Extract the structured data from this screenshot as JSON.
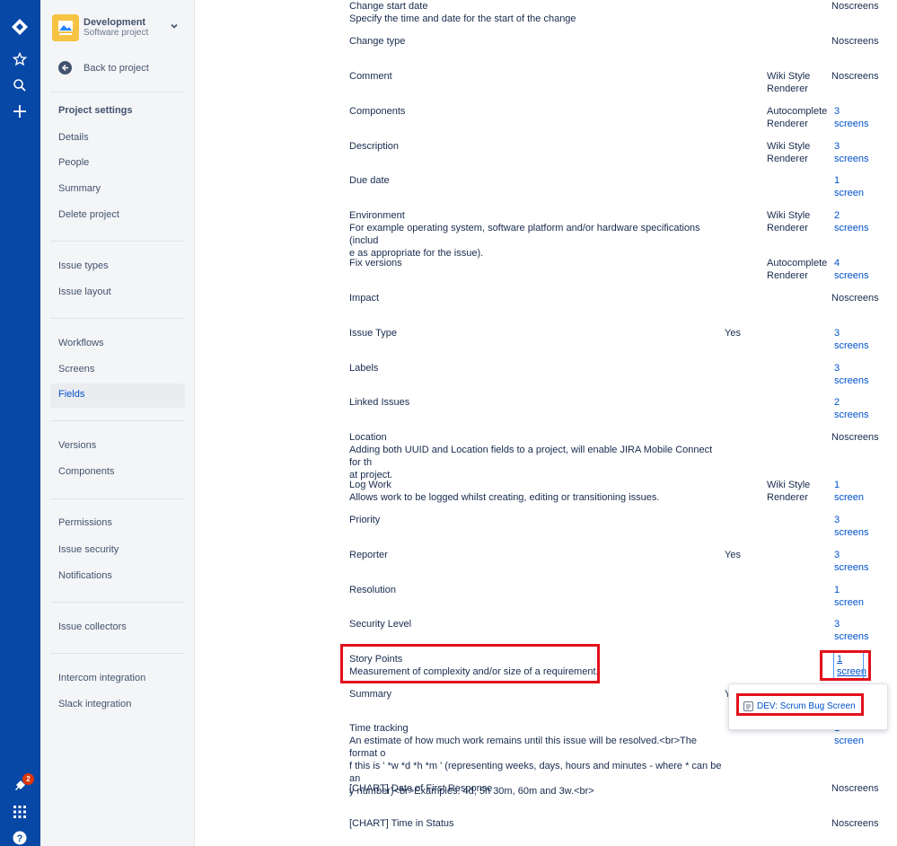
{
  "project": {
    "name": "Development",
    "type": "Software project",
    "back_label": "Back to project"
  },
  "nav": {
    "heading": "Project settings",
    "items_a": [
      "Details",
      "People",
      "Summary",
      "Delete project"
    ],
    "items_b": [
      "Issue types",
      "Issue layout"
    ],
    "items_c": [
      "Workflows",
      "Screens",
      "Fields"
    ],
    "items_d": [
      "Versions",
      "Components"
    ],
    "items_e": [
      "Permissions",
      "Issue security",
      "Notifications"
    ],
    "items_f": [
      "Issue collectors"
    ],
    "items_g": [
      "Intercom integration",
      "Slack integration"
    ],
    "active": "Fields"
  },
  "global_nav": {
    "notification_count": "2"
  },
  "fields": [
    {
      "name": "Change start date",
      "desc": [
        "Specify the time and date for the start of the change"
      ],
      "required": "",
      "renderer": [],
      "screens": [
        "No",
        "screens"
      ],
      "link": false
    },
    {
      "name": "Change type",
      "desc": [],
      "required": "",
      "renderer": [],
      "screens": [
        "No",
        "screens"
      ],
      "link": false
    },
    {
      "name": "Comment",
      "desc": [],
      "required": "",
      "renderer": [
        "Wiki Style",
        "Renderer"
      ],
      "screens": [
        "No",
        "screens"
      ],
      "link": false
    },
    {
      "name": "Components",
      "desc": [],
      "required": "",
      "renderer": [
        "Autocomplete",
        "Renderer"
      ],
      "screens": [
        "3",
        "screens"
      ],
      "link": true
    },
    {
      "name": "Description",
      "desc": [],
      "required": "",
      "renderer": [
        "Wiki Style",
        "Renderer"
      ],
      "screens": [
        "3",
        "screens"
      ],
      "link": true
    },
    {
      "name": "Due date",
      "desc": [],
      "required": "",
      "renderer": [],
      "screens": [
        "1",
        "screen"
      ],
      "link": true
    },
    {
      "name": "Environment",
      "desc": [
        "For example operating system, software platform and/or hardware specifications (includ",
        "e as appropriate for the issue)."
      ],
      "required": "",
      "renderer": [
        "Wiki Style",
        "Renderer"
      ],
      "screens": [
        "2",
        "screens"
      ],
      "link": true
    },
    {
      "name": "Fix versions",
      "desc": [],
      "required": "",
      "renderer": [
        "Autocomplete",
        "Renderer"
      ],
      "screens": [
        "4",
        "screens"
      ],
      "link": true
    },
    {
      "name": "Impact",
      "desc": [],
      "required": "",
      "renderer": [],
      "screens": [
        "No",
        "screens"
      ],
      "link": false
    },
    {
      "name": "Issue Type",
      "desc": [],
      "required": "Yes",
      "renderer": [],
      "screens": [
        "3",
        "screens"
      ],
      "link": true
    },
    {
      "name": "Labels",
      "desc": [],
      "required": "",
      "renderer": [],
      "screens": [
        "3",
        "screens"
      ],
      "link": true
    },
    {
      "name": "Linked Issues",
      "desc": [],
      "required": "",
      "renderer": [],
      "screens": [
        "2",
        "screens"
      ],
      "link": true
    },
    {
      "name": "Location",
      "desc": [
        "Adding both UUID and Location fields to a project, will enable JIRA Mobile Connect for th",
        "at project."
      ],
      "required": "",
      "renderer": [],
      "screens": [
        "No",
        "screens"
      ],
      "link": false
    },
    {
      "name": "Log Work",
      "desc": [
        "Allows work to be logged whilst creating, editing or transitioning issues."
      ],
      "required": "",
      "renderer": [
        "Wiki Style",
        "Renderer"
      ],
      "screens": [
        "1",
        "screen"
      ],
      "link": true
    },
    {
      "name": "Priority",
      "desc": [],
      "required": "",
      "renderer": [],
      "screens": [
        "3",
        "screens"
      ],
      "link": true
    },
    {
      "name": "Reporter",
      "desc": [],
      "required": "Yes",
      "renderer": [],
      "screens": [
        "3",
        "screens"
      ],
      "link": true
    },
    {
      "name": "Resolution",
      "desc": [],
      "required": "",
      "renderer": [],
      "screens": [
        "1",
        "screen"
      ],
      "link": true
    },
    {
      "name": "Security Level",
      "desc": [],
      "required": "",
      "renderer": [],
      "screens": [
        "3",
        "screens"
      ],
      "link": true
    },
    {
      "name": "Story Points",
      "desc": [
        "Measurement of complexity and/or size of a requirement."
      ],
      "required": "",
      "renderer": [],
      "screens": [
        "1",
        "screen"
      ],
      "link": true
    },
    {
      "name": "Summary",
      "desc": [],
      "required": "Y",
      "renderer": [],
      "screens": [],
      "link": true
    },
    {
      "name": "Time tracking",
      "desc": [
        "An estimate of how much work remains until this issue will be resolved.<br>The format o",
        "f this is ' *w *d *h *m ' (representing weeks, days, hours and minutes - where * can be an",
        "y number)<br>Examples: 4d, 5h 30m, 60m and 3w.<br>"
      ],
      "required": "",
      "renderer": [],
      "screens": [
        "1",
        "screen"
      ],
      "link": true
    },
    {
      "name": "[CHART] Date of First Response",
      "desc": [],
      "required": "",
      "renderer": [],
      "screens": [
        "No",
        "screens"
      ],
      "link": false
    },
    {
      "name": "[CHART] Time in Status",
      "desc": [],
      "required": "",
      "renderer": [],
      "screens": [
        "No",
        "screens"
      ],
      "link": false
    }
  ],
  "popup": {
    "link_label": "DEV: Scrum Bug Screen"
  },
  "colors": {
    "global_nav": "#0747a6",
    "link": "#0052cc",
    "highlight": "#e3101a"
  }
}
